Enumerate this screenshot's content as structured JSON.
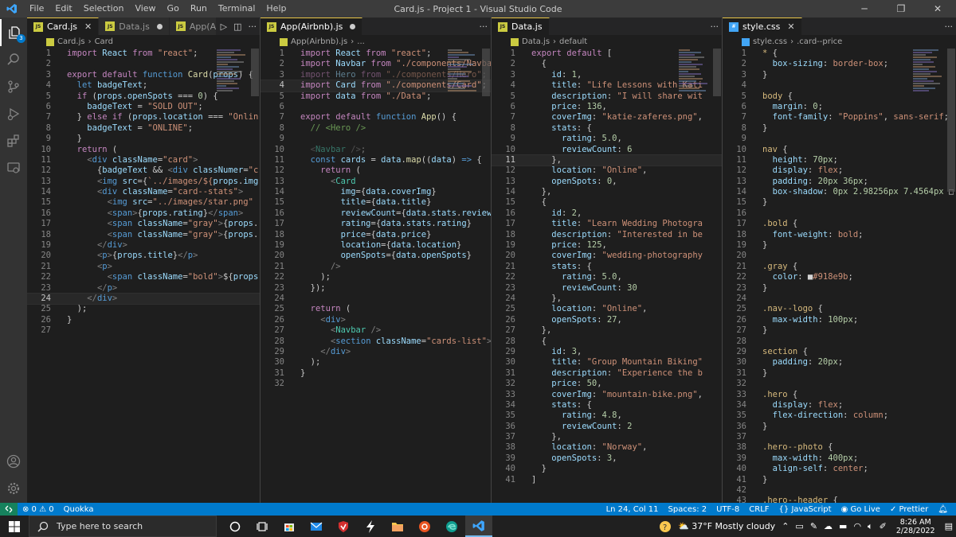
{
  "titlebar": {
    "menu": [
      "File",
      "Edit",
      "Selection",
      "View",
      "Go",
      "Run",
      "Terminal",
      "Help"
    ],
    "title": "Card.js - Project 1 - Visual Studio Code"
  },
  "activity": {
    "explorer_badge": "3"
  },
  "groups": [
    {
      "tabs": [
        {
          "label": "Card.js",
          "active": true,
          "marker": "close"
        },
        {
          "label": "Data.js",
          "active": false,
          "marker": "dot"
        },
        {
          "label": "App(Airb",
          "active": false,
          "marker": "none"
        }
      ],
      "crumbs": [
        "Card.js",
        "Card"
      ],
      "current_line": 24,
      "lines": [
        "<span class='k'>import</span> <span class='v'>React</span> <span class='k'>from</span> <span class='s'>\"react\"</span>;",
        "",
        "<span class='k'>export</span> <span class='k'>default</span> <span class='kb'>function</span> <span class='f'>Card</span>(<span class='v'>props</span>) {",
        "  <span class='kb'>let</span> <span class='v'>badgeText</span>;",
        "  <span class='k'>if</span> (<span class='v'>props</span>.<span class='v'>openSpots</span> === <span class='n'>0</span>) {",
        "    <span class='v'>badgeText</span> = <span class='s'>\"SOLD OUT\"</span>;",
        "  } <span class='k'>else</span> <span class='k'>if</span> (<span class='v'>props</span>.<span class='v'>location</span> === <span class='s'>\"Onlin</span>",
        "    <span class='v'>badgeText</span> = <span class='s'>\"ONLINE\"</span>;",
        "  }",
        "  <span class='k'>return</span> (",
        "    <span class='g'>&lt;</span><span class='kb'>div</span> <span class='v'>className</span>=<span class='s'>\"card\"</span><span class='g'>&gt;</span>",
        "      {<span class='v'>badgeText</span> &amp;&amp; <span class='g'>&lt;</span><span class='kb'>div</span> <span class='v'>classNumer</span>=<span class='s'>\"c</span>",
        "      <span class='g'>&lt;</span><span class='kb'>img</span> <span class='v'>src</span>={<span class='s'>`../images/${</span><span class='v'>props</span>.<span class='v'>img</span>",
        "      <span class='g'>&lt;</span><span class='kb'>div</span> <span class='v'>className</span>=<span class='s'>\"card--stats\"</span><span class='g'>&gt;</span>",
        "        <span class='g'>&lt;</span><span class='kb'>img</span> <span class='v'>src</span>=<span class='s'>\"../images/star.png\"</span>",
        "        <span class='g'>&lt;</span><span class='kb'>span</span><span class='g'>&gt;</span>{<span class='v'>props</span>.<span class='v'>rating</span>}<span class='g'>&lt;/</span><span class='kb'>span</span><span class='g'>&gt;</span>",
        "        <span class='g'>&lt;</span><span class='kb'>span</span> <span class='v'>className</span>=<span class='s'>\"gray\"</span><span class='g'>&gt;</span>{<span class='v'>props</span>.",
        "        <span class='g'>&lt;</span><span class='kb'>span</span> <span class='v'>className</span>=<span class='s'>\"gray\"</span><span class='g'>&gt;</span>{<span class='v'>props</span>.",
        "      <span class='g'>&lt;/</span><span class='kb'>div</span><span class='g'>&gt;</span>",
        "      <span class='g'>&lt;</span><span class='kb'>p</span><span class='g'>&gt;</span>{<span class='v'>props</span>.<span class='v'>title</span>}<span class='g'>&lt;/</span><span class='kb'>p</span><span class='g'>&gt;</span>",
        "      <span class='g'>&lt;</span><span class='kb'>p</span><span class='g'>&gt;</span>",
        "        <span class='g'>&lt;</span><span class='kb'>span</span> <span class='v'>className</span>=<span class='s'>\"bold\"</span><span class='g'>&gt;</span>${<span class='v'>props</span>",
        "      <span class='g'>&lt;/</span><span class='kb'>p</span><span class='g'>&gt;</span>",
        "    <span class='g'>&lt;/</span><span class='kb'>div</span><span class='g'>&gt;</span>",
        "  );",
        "}",
        ""
      ]
    },
    {
      "tabs": [
        {
          "label": "App(Airbnb).js",
          "active": true,
          "marker": "dot"
        }
      ],
      "crumbs": [
        "App(Airbnb).js",
        "..."
      ],
      "current_line": 4,
      "lines": [
        "<span class='k'>import</span> <span class='v'>React</span> <span class='k'>from</span> <span class='s'>\"react\"</span>;",
        "<span class='k'>import</span> <span class='v'>Navbar</span> <span class='k'>from</span> <span class='s'>\"./components/Navba</span>",
        "<span class='dim'><span class='k'>import</span> <span class='v'>Hero</span> <span class='k'>from</span> <span class='s'>\"./components/Hero\"</span>;</span>",
        "<span class='k'>import</span> <span class='v'>Card</span> <span class='k'>from</span> <span class='s'>\"./components/Card\"</span>;",
        "<span class='k'>import</span> <span class='v'>data</span> <span class='k'>from</span> <span class='s'>\"./Data\"</span>;",
        "",
        "<span class='k'>export</span> <span class='k'>default</span> <span class='kb'>function</span> <span class='f'>App</span>() {",
        "  <span class='c'>// &lt;Hero /&gt;</span>",
        "",
        "  <span class='dim'><span class='g'>&lt;</span><span class='t'>Navbar</span> <span class='g'>/&gt;</span>;</span>",
        "  <span class='kb'>const</span> <span class='v'>cards</span> = <span class='v'>data</span>.<span class='f'>map</span>((<span class='v'>data</span>) <span class='kb'>=&gt;</span> {",
        "    <span class='k'>return</span> (",
        "      <span class='g'>&lt;</span><span class='t'>Card</span>",
        "        <span class='v'>img</span>={<span class='v'>data</span>.<span class='v'>coverImg</span>}",
        "        <span class='v'>title</span>={<span class='v'>data</span>.<span class='v'>title</span>}",
        "        <span class='v'>reviewCount</span>={<span class='v'>data</span>.<span class='v'>stats</span>.<span class='v'>review</span>",
        "        <span class='v'>rating</span>={<span class='v'>data</span>.<span class='v'>stats</span>.<span class='v'>rating</span>}",
        "        <span class='v'>price</span>={<span class='v'>data</span>.<span class='v'>price</span>}",
        "        <span class='v'>location</span>={<span class='v'>data</span>.<span class='v'>location</span>}",
        "        <span class='v'>openSpots</span>={<span class='v'>data</span>.<span class='v'>openSpots</span>}",
        "      <span class='g'>/&gt;</span>",
        "    );",
        "  });",
        "",
        "  <span class='k'>return</span> (",
        "    <span class='g'>&lt;</span><span class='kb'>div</span><span class='g'>&gt;</span>",
        "      <span class='g'>&lt;</span><span class='t'>Navbar</span> <span class='g'>/&gt;</span>",
        "      <span class='g'>&lt;</span><span class='kb'>section</span> <span class='v'>className</span>=<span class='s'>\"cards-list\"</span><span class='g'>&gt;</span>",
        "    <span class='g'>&lt;/</span><span class='kb'>div</span><span class='g'>&gt;</span>",
        "  );",
        "}",
        ""
      ]
    },
    {
      "tabs": [
        {
          "label": "Data.js",
          "active": true,
          "marker": "none"
        }
      ],
      "crumbs": [
        "Data.js",
        "default"
      ],
      "current_line": 11,
      "lines": [
        "<span class='k'>export</span> <span class='k'>default</span> [",
        "  {",
        "    <span class='v'>id</span>: <span class='n'>1</span>,",
        "    <span class='v'>title</span>: <span class='s'>\"Life Lessons with Kati</span>",
        "    <span class='v'>description</span>: <span class='s'>\"I will share wit</span>",
        "    <span class='v'>price</span>: <span class='n'>136</span>,",
        "    <span class='v'>coverImg</span>: <span class='s'>\"katie-zaferes.png\"</span>,",
        "    <span class='v'>stats</span>: {",
        "      <span class='v'>rating</span>: <span class='n'>5.0</span>,",
        "      <span class='v'>reviewCount</span>: <span class='n'>6</span>",
        "    },",
        "    <span class='v'>location</span>: <span class='s'>\"Online\"</span>,",
        "    <span class='v'>openSpots</span>: <span class='n'>0</span>,",
        "  },",
        "  {",
        "    <span class='v'>id</span>: <span class='n'>2</span>,",
        "    <span class='v'>title</span>: <span class='s'>\"Learn Wedding Photogra</span>",
        "    <span class='v'>description</span>: <span class='s'>\"Interested in be</span>",
        "    <span class='v'>price</span>: <span class='n'>125</span>,",
        "    <span class='v'>coverImg</span>: <span class='s'>\"wedding-photography</span>",
        "    <span class='v'>stats</span>: {",
        "      <span class='v'>rating</span>: <span class='n'>5.0</span>,",
        "      <span class='v'>reviewCount</span>: <span class='n'>30</span>",
        "    },",
        "    <span class='v'>location</span>: <span class='s'>\"Online\"</span>,",
        "    <span class='v'>openSpots</span>: <span class='n'>27</span>,",
        "  },",
        "  {",
        "    <span class='v'>id</span>: <span class='n'>3</span>,",
        "    <span class='v'>title</span>: <span class='s'>\"Group Mountain Biking\"</span>",
        "    <span class='v'>description</span>: <span class='s'>\"Experience the b</span>",
        "    <span class='v'>price</span>: <span class='n'>50</span>,",
        "    <span class='v'>coverImg</span>: <span class='s'>\"mountain-bike.png\"</span>,",
        "    <span class='v'>stats</span>: {",
        "      <span class='v'>rating</span>: <span class='n'>4.8</span>,",
        "      <span class='v'>reviewCount</span>: <span class='n'>2</span>",
        "    },",
        "    <span class='v'>location</span>: <span class='s'>\"Norway\"</span>,",
        "    <span class='v'>openSpots</span>: <span class='n'>3</span>,",
        "  }",
        "]"
      ]
    },
    {
      "tabs": [
        {
          "label": "style.css",
          "active": true,
          "marker": "close"
        }
      ],
      "crumbs": [
        "style.css",
        ".card--price"
      ],
      "current_line": 0,
      "lines": [
        "<span class='sel'>*</span> {",
        "  <span class='v'>box-sizing</span>: <span class='s'>border-box</span>;",
        "}",
        "",
        "<span class='sel'>body</span> {",
        "  <span class='v'>margin</span>: <span class='n'>0</span>;",
        "  <span class='v'>font-family</span>: <span class='s'>\"Poppins\"</span>, <span class='s'>sans-serif</span>;",
        "}",
        "",
        "<span class='sel'>nav</span> {",
        "  <span class='v'>height</span>: <span class='n'>70px</span>;",
        "  <span class='v'>display</span>: <span class='s'>flex</span>;",
        "  <span class='v'>padding</span>: <span class='n'>20px 36px</span>;",
        "  <span class='v'>box-shadow</span>: <span class='n'>0px 2.98256px 7.4564px</span> <span class='p'>□</span>",
        "}",
        "",
        "<span class='sel'>.bold</span> {",
        "  <span class='v'>font-weight</span>: <span class='s'>bold</span>;",
        "}",
        "",
        "<span class='sel'>.gray</span> {",
        "  <span class='v'>color</span>: <span class='p'>■</span><span class='s'>#918e9b</span>;",
        "}",
        "",
        "<span class='sel'>.nav--logo</span> {",
        "  <span class='v'>max-width</span>: <span class='n'>100px</span>;",
        "}",
        "",
        "<span class='sel'>section</span> {",
        "  <span class='v'>padding</span>: <span class='n'>20px</span>;",
        "}",
        "",
        "<span class='sel'>.hero</span> {",
        "  <span class='v'>display</span>: <span class='s'>flex</span>;",
        "  <span class='v'>flex-direction</span>: <span class='s'>column</span>;",
        "}",
        "",
        "<span class='sel'>.hero--photo</span> {",
        "  <span class='v'>max-width</span>: <span class='n'>400px</span>;",
        "  <span class='v'>align-self</span>: <span class='s'>center</span>;",
        "}",
        "",
        "<span class='sel'>.hero--header</span> {"
      ]
    }
  ],
  "statusbar": {
    "problems": "⊗ 0 ⚠ 0",
    "quokka": "Quokka",
    "position": "Ln 24, Col 11",
    "spaces": "Spaces: 2",
    "encoding": "UTF-8",
    "eol": "CRLF",
    "language": "{} JavaScript",
    "golive": "Go Live",
    "prettier": "✓ Prettier"
  },
  "taskbar": {
    "search_placeholder": "Type here to search",
    "weather": "37°F  Mostly cloudy",
    "time": "8:26 AM",
    "date": "2/28/2022"
  },
  "colors": {
    "accent": "#007acc",
    "remote": "#16825d",
    "editor_bg": "#1e1e1e"
  }
}
